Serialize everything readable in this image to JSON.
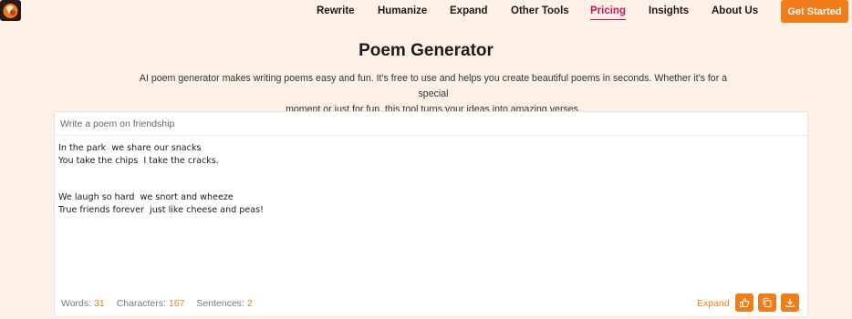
{
  "nav": {
    "items": [
      {
        "label": "Rewrite"
      },
      {
        "label": "Humanize"
      },
      {
        "label": "Expand"
      },
      {
        "label": "Other Tools"
      },
      {
        "label": "Pricing",
        "active": true
      },
      {
        "label": "Insights"
      },
      {
        "label": "About Us"
      }
    ],
    "cta_label": "Get Started"
  },
  "page": {
    "title": "Poem Generator",
    "description_line1": "AI poem generator makes writing poems easy and fun. It's free to use and helps you create beautiful poems in seconds. Whether it's for a special",
    "description_line2": "moment or just for fun, this tool turns your ideas into amazing verses."
  },
  "editor": {
    "prompt_placeholder": "Write a poem on friendship",
    "prompt_value": "",
    "poem_text": "In the park  we share our snacks\nYou take the chips  I take the cracks.\n\n\nWe laugh so hard  we snort and wheeze\nTrue friends forever  just like cheese and peas!"
  },
  "stats": {
    "words_label": "Words:",
    "words": "31",
    "characters_label": "Characters:",
    "characters": "167",
    "sentences_label": "Sentences:",
    "sentences": "2"
  },
  "actions": {
    "expand_label": "Expand",
    "buttons": [
      "thumbs-up-icon",
      "copy-icon",
      "download-icon"
    ]
  },
  "colors": {
    "accent": "#f07c1a",
    "active_nav": "#c2185b",
    "background": "#fdf1e7"
  }
}
